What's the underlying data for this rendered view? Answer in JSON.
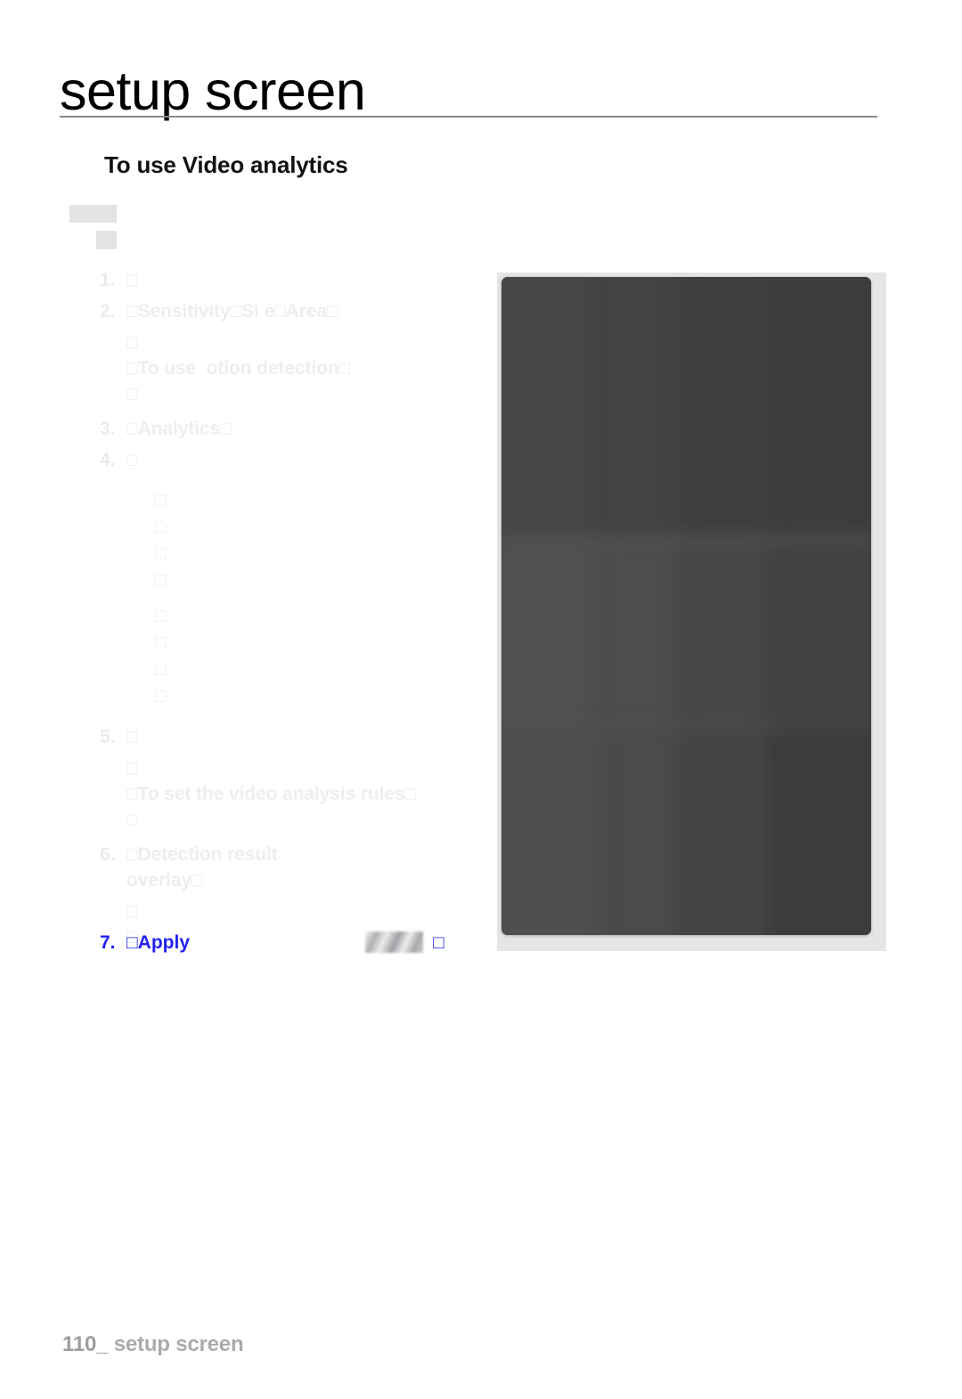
{
  "page": {
    "title": "setup screen",
    "section_heading": "To use Video analytics",
    "footer_page_number": "110_",
    "footer_label": "setup screen"
  },
  "colors": {
    "heading": "#121212",
    "rule": "#8a8a8a",
    "faded_body_text": "#eceef0",
    "highlight_blue": "#2222ee",
    "footer_text": "#a9abad",
    "panel_frame": "#e3e5e7",
    "panel_interior": "#434343",
    "ghost_block": "#e2e4e6"
  },
  "ghost_blocks": [
    {
      "name": "ghost-block-wide"
    },
    {
      "name": "ghost-block-small"
    }
  ],
  "instructions": [
    {
      "number": "1.",
      "lines": [
        "□"
      ],
      "sub_lines": []
    },
    {
      "number": "2.",
      "lines": [
        "□Sensitivity□Si e□Area□"
      ],
      "sub_lines": [
        "□",
        "□To use  otion detection□",
        "□"
      ]
    },
    {
      "number": "3.",
      "lines": [
        "□Analytics□"
      ],
      "sub_lines": []
    },
    {
      "number": "4.",
      "lines": [
        "□"
      ],
      "sub_lines": []
    }
  ],
  "bullets": [
    "□",
    "□",
    "□",
    "□",
    "□",
    "□",
    "□",
    "□"
  ],
  "instructions_cont": [
    {
      "number": "5.",
      "lines": [
        "□"
      ],
      "sub_lines": [
        "□",
        "□To set the video analysis rules□",
        "□"
      ]
    },
    {
      "number": "6.",
      "lines": [
        "□Detection result",
        "overlay□"
      ],
      "sub_lines": [
        "□",
        "□"
      ]
    }
  ],
  "apply_step": {
    "number": "7.",
    "label": "□Apply",
    "trailing_glyph": "□",
    "thumbnail_name": "inline-button-thumbnail"
  },
  "screenshot_panel": {
    "name": "video-analytics-setup-screenshot",
    "description": "blurred dark setup screen capture"
  }
}
